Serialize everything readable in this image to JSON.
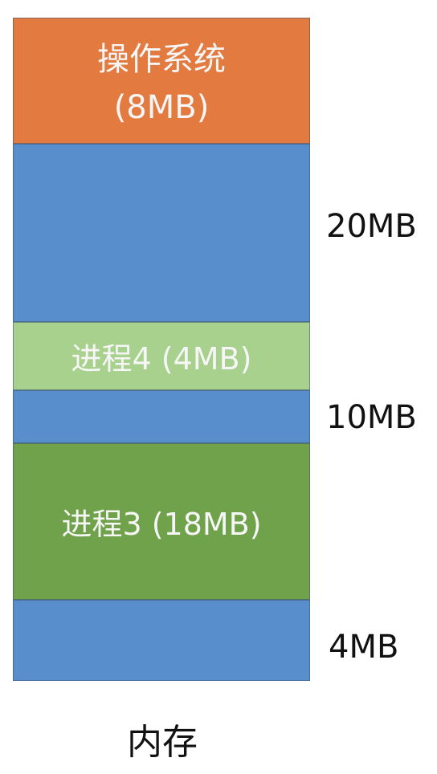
{
  "memory": {
    "os": {
      "line1": "操作系统",
      "line2": "(8MB)",
      "color": "#e37a3f"
    },
    "process4": {
      "label": "进程4 (4MB)",
      "color": "#a9d18e"
    },
    "process3": {
      "label": "进程3 (18MB)",
      "color": "#6fa24a"
    },
    "free_color": "#578ecb",
    "free_sizes": [
      "20MB",
      "10MB",
      "4MB"
    ]
  },
  "caption": "内存"
}
